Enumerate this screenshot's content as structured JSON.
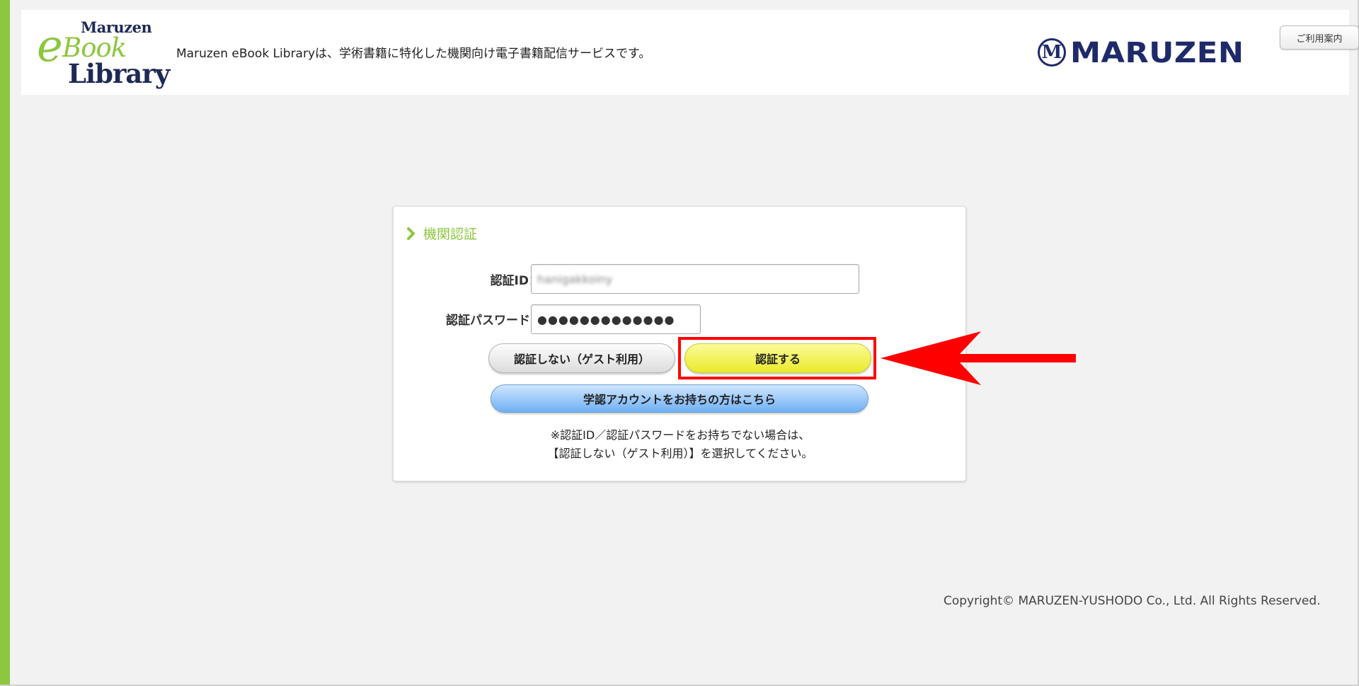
{
  "header": {
    "logo": {
      "maruzen": "Maruzen",
      "e": "e",
      "book": "Book",
      "library": "Library"
    },
    "tagline": "Maruzen eBook Libraryは、学術書籍に特化した機関向け電子書籍配信サービスです。",
    "brand": {
      "mark": "M",
      "name": "MARUZEN"
    },
    "help_label": "ご利用案内"
  },
  "auth": {
    "title": "機関認証",
    "id_label": "認証ID：",
    "id_value": "hanigakkoiny",
    "password_label": "認証パスワード：",
    "password_value": "●●●●●●●●●●●●●",
    "guest_button": "認証しない（ゲスト利用）",
    "submit_button": "認証する",
    "academic_button": "学認アカウントをお持ちの方はこちら",
    "note_line1": "※認証ID／認証パスワードをお持ちでない場合は、",
    "note_line2": "【認証しない（ゲスト利用）】を選択してください。"
  },
  "footer": {
    "copyright": "Copyright© MARUZEN-YUSHODO Co., Ltd. All Rights Reserved."
  },
  "colors": {
    "accent_green": "#8dc63f",
    "brand_navy": "#1e2a6a",
    "annotation_red": "#ff0000",
    "auth_button_yellow": "#eaea2a",
    "academic_button_blue": "#6fb0f3"
  }
}
